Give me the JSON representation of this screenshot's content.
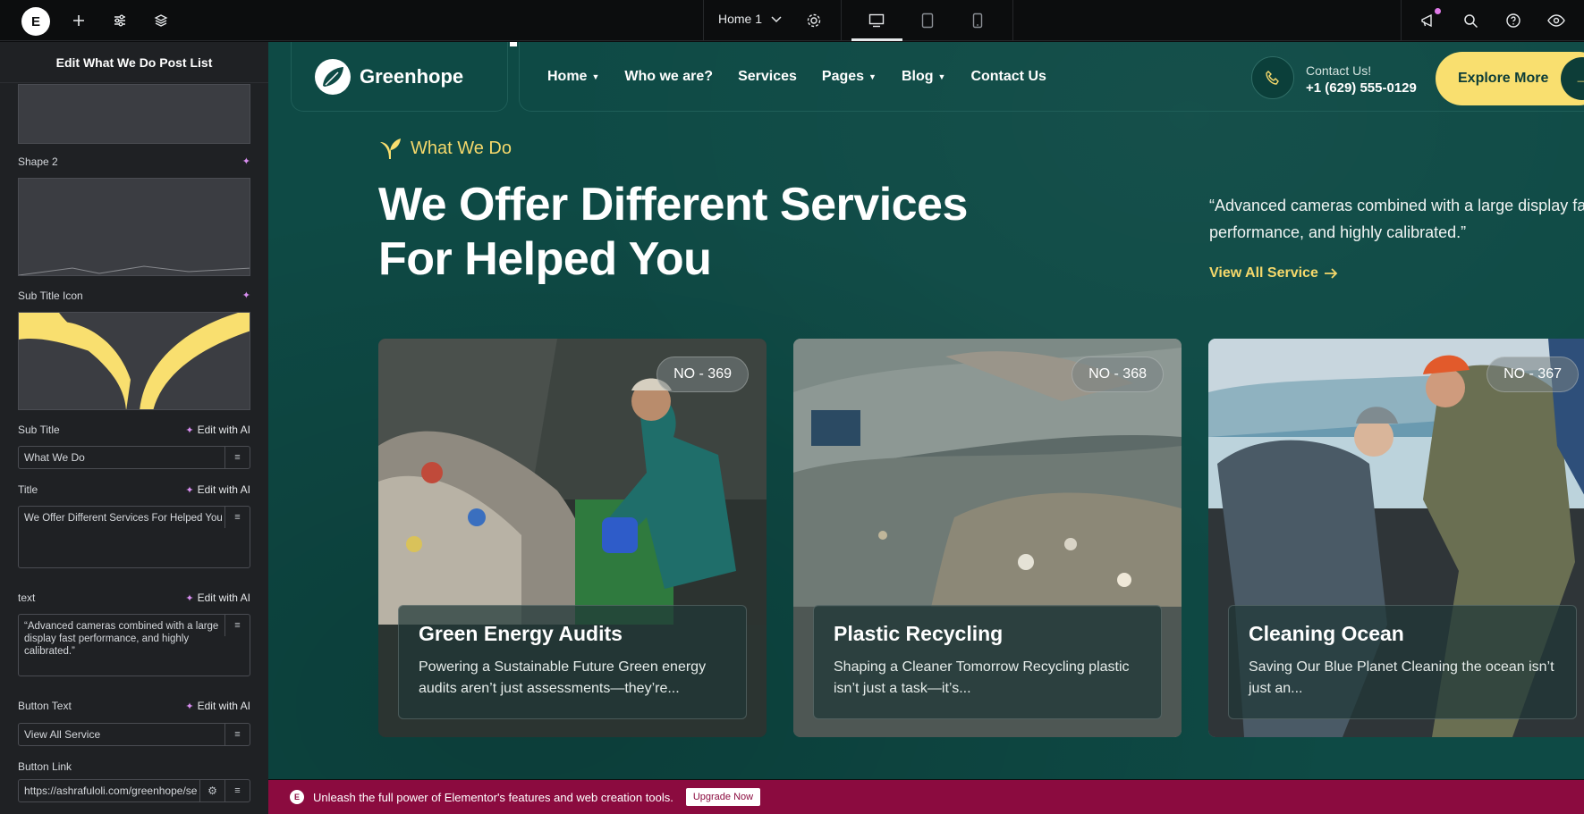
{
  "colors": {
    "canvas_bg": "#0e4a45",
    "accent_yellow": "#f9df6f",
    "promo_bg": "#8b0b3f",
    "sidebar_bg": "#1f2124"
  },
  "topbar": {
    "logo_letter": "E",
    "page_name": "Home 1",
    "icons": [
      "add-icon",
      "settings-sliders-icon",
      "layers-icon",
      "gear-icon",
      "desktop-icon",
      "tablet-icon",
      "mobile-icon",
      "megaphone-icon",
      "search-icon",
      "help-icon",
      "eye-icon"
    ]
  },
  "sidebar": {
    "header": "Edit What We Do Post List",
    "shape2_label": "Shape 2",
    "subtitle_icon_label": "Sub Title Icon",
    "edit_ai": "Edit with AI",
    "fields": {
      "sub_title": {
        "label": "Sub Title",
        "value": "What We Do"
      },
      "title": {
        "label": "Title",
        "value": "We Offer Different Services For Helped You"
      },
      "text": {
        "label": "text",
        "value": "“Advanced cameras combined with a large display fast performance, and highly calibrated.”"
      },
      "button_text": {
        "label": "Button Text",
        "value": "View All Service"
      },
      "button_link": {
        "label": "Button Link",
        "value": "https://ashrafuloli.com/greenhope/se"
      }
    }
  },
  "site": {
    "logo_text": "Greenhope",
    "nav": [
      {
        "label": "Home",
        "dropdown": true
      },
      {
        "label": "Who we are?",
        "dropdown": false
      },
      {
        "label": "Services",
        "dropdown": false
      },
      {
        "label": "Pages",
        "dropdown": true
      },
      {
        "label": "Blog",
        "dropdown": true
      },
      {
        "label": "Contact Us",
        "dropdown": false
      }
    ],
    "contact_label": "Contact Us!",
    "contact_phone": "+1 (629) 555-0129",
    "explore_button": "Explore More",
    "subtitle": "What We Do",
    "headline": "We Offer Different Services For Helped You",
    "quote": "“Advanced cameras combined with a large display fast performance, and highly calibrated.”",
    "view_all": "View All Service",
    "cards": [
      {
        "badge": "NO - 369",
        "title": "Green Energy Audits",
        "text": "Powering a Sustainable Future Green energy audits aren’t just assessments—they’re..."
      },
      {
        "badge": "NO - 368",
        "title": "Plastic Recycling",
        "text": "Shaping a Cleaner Tomorrow Recycling plastic isn’t just a task—it’s..."
      },
      {
        "badge": "NO - 367",
        "title": "Cleaning Ocean",
        "text": "Saving Our Blue Planet Cleaning the ocean isn’t just an..."
      }
    ]
  },
  "promo": {
    "text": "Unleash the full power of Elementor's features and web creation tools.",
    "button": "Upgrade Now"
  }
}
